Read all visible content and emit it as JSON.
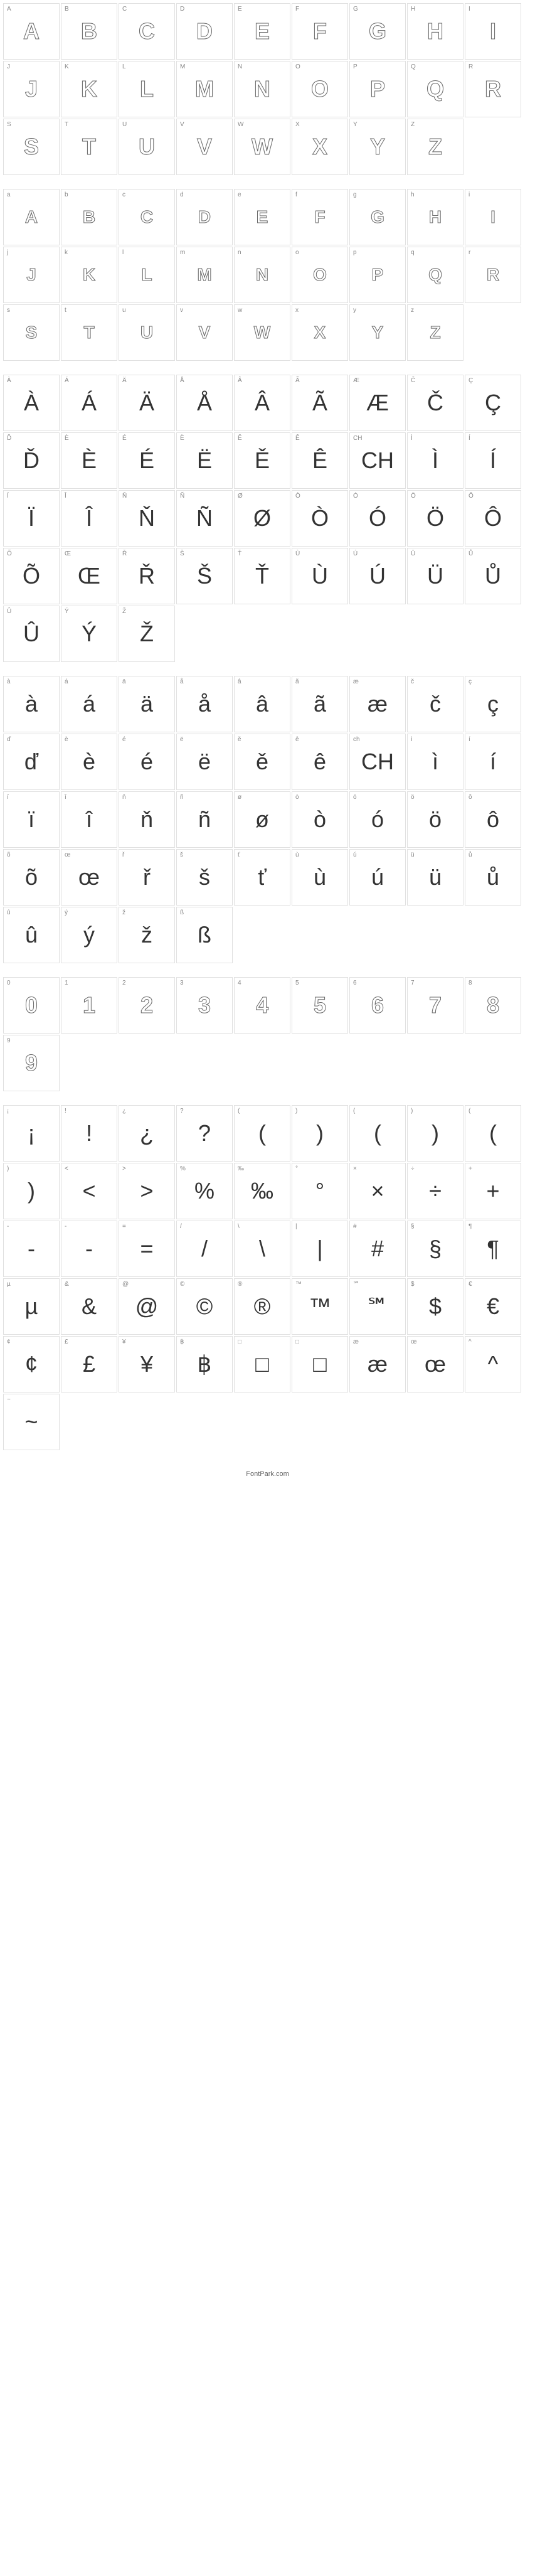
{
  "uppercase": [
    {
      "label": "A",
      "glyph": "A"
    },
    {
      "label": "B",
      "glyph": "B"
    },
    {
      "label": "C",
      "glyph": "C"
    },
    {
      "label": "D",
      "glyph": "D"
    },
    {
      "label": "E",
      "glyph": "E"
    },
    {
      "label": "F",
      "glyph": "F"
    },
    {
      "label": "G",
      "glyph": "G"
    },
    {
      "label": "H",
      "glyph": "H"
    },
    {
      "label": "I",
      "glyph": "I"
    },
    {
      "label": "J",
      "glyph": "J"
    },
    {
      "label": "K",
      "glyph": "K"
    },
    {
      "label": "L",
      "glyph": "L"
    },
    {
      "label": "M",
      "glyph": "M"
    },
    {
      "label": "N",
      "glyph": "N"
    },
    {
      "label": "O",
      "glyph": "O"
    },
    {
      "label": "P",
      "glyph": "P"
    },
    {
      "label": "Q",
      "glyph": "Q"
    },
    {
      "label": "R",
      "glyph": "R"
    },
    {
      "label": "S",
      "glyph": "S"
    },
    {
      "label": "T",
      "glyph": "T"
    },
    {
      "label": "U",
      "glyph": "U"
    },
    {
      "label": "V",
      "glyph": "V"
    },
    {
      "label": "W",
      "glyph": "W"
    },
    {
      "label": "X",
      "glyph": "X"
    },
    {
      "label": "Y",
      "glyph": "Y"
    },
    {
      "label": "Z",
      "glyph": "Z"
    }
  ],
  "lowercase": [
    {
      "label": "a",
      "glyph": "A"
    },
    {
      "label": "b",
      "glyph": "B"
    },
    {
      "label": "c",
      "glyph": "C"
    },
    {
      "label": "d",
      "glyph": "D"
    },
    {
      "label": "e",
      "glyph": "E"
    },
    {
      "label": "f",
      "glyph": "F"
    },
    {
      "label": "g",
      "glyph": "G"
    },
    {
      "label": "h",
      "glyph": "H"
    },
    {
      "label": "i",
      "glyph": "I"
    },
    {
      "label": "j",
      "glyph": "J"
    },
    {
      "label": "k",
      "glyph": "K"
    },
    {
      "label": "l",
      "glyph": "L"
    },
    {
      "label": "m",
      "glyph": "M"
    },
    {
      "label": "n",
      "glyph": "N"
    },
    {
      "label": "o",
      "glyph": "O"
    },
    {
      "label": "p",
      "glyph": "P"
    },
    {
      "label": "q",
      "glyph": "Q"
    },
    {
      "label": "r",
      "glyph": "R"
    },
    {
      "label": "s",
      "glyph": "S"
    },
    {
      "label": "t",
      "glyph": "T"
    },
    {
      "label": "u",
      "glyph": "U"
    },
    {
      "label": "v",
      "glyph": "V"
    },
    {
      "label": "w",
      "glyph": "W"
    },
    {
      "label": "x",
      "glyph": "X"
    },
    {
      "label": "y",
      "glyph": "Y"
    },
    {
      "label": "z",
      "glyph": "Z"
    }
  ],
  "accented_upper": [
    {
      "label": "À",
      "glyph": "À"
    },
    {
      "label": "Á",
      "glyph": "Á"
    },
    {
      "label": "Ä",
      "glyph": "Ä"
    },
    {
      "label": "Å",
      "glyph": "Å"
    },
    {
      "label": "Â",
      "glyph": "Â"
    },
    {
      "label": "Ã",
      "glyph": "Ã"
    },
    {
      "label": "Æ",
      "glyph": "Æ"
    },
    {
      "label": "Č",
      "glyph": "Č"
    },
    {
      "label": "Ç",
      "glyph": "Ç"
    },
    {
      "label": "Ď",
      "glyph": "Ď"
    },
    {
      "label": "È",
      "glyph": "È"
    },
    {
      "label": "É",
      "glyph": "É"
    },
    {
      "label": "Ë",
      "glyph": "Ë"
    },
    {
      "label": "Ě",
      "glyph": "Ě"
    },
    {
      "label": "Ê",
      "glyph": "Ê"
    },
    {
      "label": "CH",
      "glyph": "CH"
    },
    {
      "label": "Ì",
      "glyph": "Ì"
    },
    {
      "label": "Í",
      "glyph": "Í"
    },
    {
      "label": "Ï",
      "glyph": "Ï"
    },
    {
      "label": "Î",
      "glyph": "Î"
    },
    {
      "label": "Ň",
      "glyph": "Ň"
    },
    {
      "label": "Ñ",
      "glyph": "Ñ"
    },
    {
      "label": "Ø",
      "glyph": "Ø"
    },
    {
      "label": "Ò",
      "glyph": "Ò"
    },
    {
      "label": "Ó",
      "glyph": "Ó"
    },
    {
      "label": "Ö",
      "glyph": "Ö"
    },
    {
      "label": "Ô",
      "glyph": "Ô"
    },
    {
      "label": "Õ",
      "glyph": "Õ"
    },
    {
      "label": "Œ",
      "glyph": "Œ"
    },
    {
      "label": "Ř",
      "glyph": "Ř"
    },
    {
      "label": "Š",
      "glyph": "Š"
    },
    {
      "label": "Ť",
      "glyph": "Ť"
    },
    {
      "label": "Ù",
      "glyph": "Ù"
    },
    {
      "label": "Ú",
      "glyph": "Ú"
    },
    {
      "label": "Ü",
      "glyph": "Ü"
    },
    {
      "label": "Ů",
      "glyph": "Ů"
    },
    {
      "label": "Û",
      "glyph": "Û"
    },
    {
      "label": "Ý",
      "glyph": "Ý"
    },
    {
      "label": "Ž",
      "glyph": "Ž"
    }
  ],
  "accented_lower": [
    {
      "label": "à",
      "glyph": "à"
    },
    {
      "label": "á",
      "glyph": "á"
    },
    {
      "label": "ä",
      "glyph": "ä"
    },
    {
      "label": "å",
      "glyph": "å"
    },
    {
      "label": "â",
      "glyph": "â"
    },
    {
      "label": "ã",
      "glyph": "ã"
    },
    {
      "label": "æ",
      "glyph": "æ"
    },
    {
      "label": "č",
      "glyph": "č"
    },
    {
      "label": "ç",
      "glyph": "ç"
    },
    {
      "label": "ď",
      "glyph": "ď"
    },
    {
      "label": "è",
      "glyph": "è"
    },
    {
      "label": "é",
      "glyph": "é"
    },
    {
      "label": "ë",
      "glyph": "ë"
    },
    {
      "label": "ě",
      "glyph": "ě"
    },
    {
      "label": "ê",
      "glyph": "ê"
    },
    {
      "label": "ch",
      "glyph": "CH"
    },
    {
      "label": "ì",
      "glyph": "ì"
    },
    {
      "label": "í",
      "glyph": "í"
    },
    {
      "label": "ï",
      "glyph": "ï"
    },
    {
      "label": "î",
      "glyph": "î"
    },
    {
      "label": "ň",
      "glyph": "ň"
    },
    {
      "label": "ñ",
      "glyph": "ñ"
    },
    {
      "label": "ø",
      "glyph": "ø"
    },
    {
      "label": "ò",
      "glyph": "ò"
    },
    {
      "label": "ó",
      "glyph": "ó"
    },
    {
      "label": "ö",
      "glyph": "ö"
    },
    {
      "label": "ô",
      "glyph": "ô"
    },
    {
      "label": "õ",
      "glyph": "õ"
    },
    {
      "label": "œ",
      "glyph": "œ"
    },
    {
      "label": "ř",
      "glyph": "ř"
    },
    {
      "label": "š",
      "glyph": "š"
    },
    {
      "label": "ť",
      "glyph": "ť"
    },
    {
      "label": "ù",
      "glyph": "ù"
    },
    {
      "label": "ú",
      "glyph": "ú"
    },
    {
      "label": "ü",
      "glyph": "ü"
    },
    {
      "label": "ů",
      "glyph": "ů"
    },
    {
      "label": "û",
      "glyph": "û"
    },
    {
      "label": "ý",
      "glyph": "ý"
    },
    {
      "label": "ž",
      "glyph": "ž"
    },
    {
      "label": "ß",
      "glyph": "ß"
    }
  ],
  "numbers": [
    {
      "label": "0",
      "glyph": "0"
    },
    {
      "label": "1",
      "glyph": "1"
    },
    {
      "label": "2",
      "glyph": "2"
    },
    {
      "label": "3",
      "glyph": "3"
    },
    {
      "label": "4",
      "glyph": "4"
    },
    {
      "label": "5",
      "glyph": "5"
    },
    {
      "label": "6",
      "glyph": "6"
    },
    {
      "label": "7",
      "glyph": "7"
    },
    {
      "label": "8",
      "glyph": "8"
    },
    {
      "label": "9",
      "glyph": "9"
    }
  ],
  "symbols": [
    {
      "label": "¡",
      "glyph": "¡"
    },
    {
      "label": "!",
      "glyph": "!"
    },
    {
      "label": "¿",
      "glyph": "¿"
    },
    {
      "label": "?",
      "glyph": "?"
    },
    {
      "label": "(",
      "glyph": "("
    },
    {
      "label": ")",
      "glyph": ")"
    },
    {
      "label": "(",
      "glyph": "("
    },
    {
      "label": ")",
      "glyph": ")"
    },
    {
      "label": "(",
      "glyph": "("
    },
    {
      "label": ")",
      "glyph": ")"
    },
    {
      "label": "<",
      "glyph": "<"
    },
    {
      "label": ">",
      "glyph": ">"
    },
    {
      "label": "%",
      "glyph": "%"
    },
    {
      "label": "‰",
      "glyph": "‰"
    },
    {
      "label": "°",
      "glyph": "°"
    },
    {
      "label": "×",
      "glyph": "×"
    },
    {
      "label": "÷",
      "glyph": "÷"
    },
    {
      "label": "+",
      "glyph": "+"
    },
    {
      "label": "-",
      "glyph": "-"
    },
    {
      "label": "-",
      "glyph": "-"
    },
    {
      "label": "=",
      "glyph": "="
    },
    {
      "label": "/",
      "glyph": "/"
    },
    {
      "label": "\\",
      "glyph": "\\"
    },
    {
      "label": "|",
      "glyph": "|"
    },
    {
      "label": "#",
      "glyph": "#"
    },
    {
      "label": "§",
      "glyph": "§"
    },
    {
      "label": "¶",
      "glyph": "¶"
    },
    {
      "label": "µ",
      "glyph": "µ"
    },
    {
      "label": "&",
      "glyph": "&"
    },
    {
      "label": "@",
      "glyph": "@"
    },
    {
      "label": "©",
      "glyph": "©"
    },
    {
      "label": "®",
      "glyph": "®"
    },
    {
      "label": "™",
      "glyph": "™"
    },
    {
      "label": "℠",
      "glyph": "℠"
    },
    {
      "label": "$",
      "glyph": "$"
    },
    {
      "label": "€",
      "glyph": "€"
    },
    {
      "label": "¢",
      "glyph": "¢"
    },
    {
      "label": "£",
      "glyph": "£"
    },
    {
      "label": "¥",
      "glyph": "¥"
    },
    {
      "label": "฿",
      "glyph": "฿"
    },
    {
      "label": "□",
      "glyph": "□"
    },
    {
      "label": "□",
      "glyph": "□"
    },
    {
      "label": "æ",
      "glyph": "æ"
    },
    {
      "label": "œ",
      "glyph": "œ"
    },
    {
      "label": "^",
      "glyph": "^"
    },
    {
      "label": "~",
      "glyph": "~"
    }
  ],
  "footer_text": "FontPark.com"
}
